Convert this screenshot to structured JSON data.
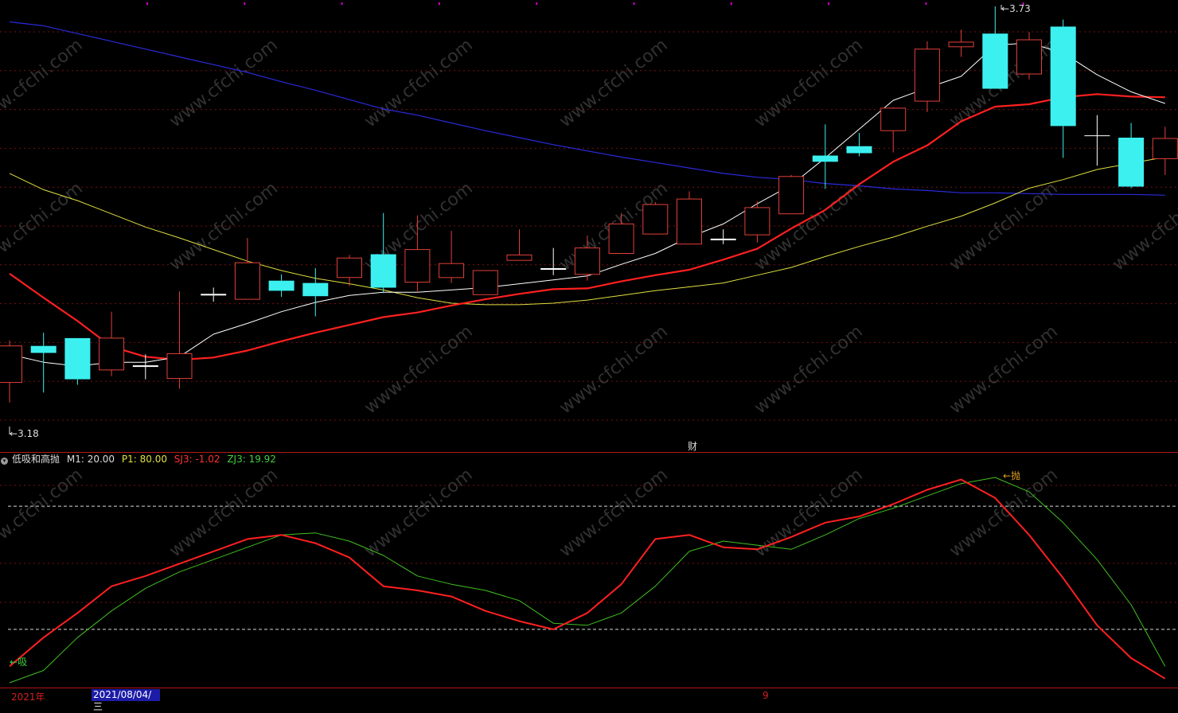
{
  "colors": {
    "background": "#000000",
    "grid": "#7a1010",
    "frame": "#b01818",
    "up": "#e0403a",
    "down": "#3cf0f0",
    "ma5": "#ffffff",
    "ma10": "#ff2020",
    "ma30": "#e0e040",
    "ma60": "#2a2adc",
    "k_line": "#ff2020",
    "d_line": "#40c020"
  },
  "top_markers": [
    "#cc00cc",
    "#cc00cc",
    "#cc00cc",
    "#cc00cc",
    "#cc00cc",
    "#cc00cc",
    "#cc00cc",
    "#cc00cc",
    "#cc00cc",
    "#cc00cc"
  ],
  "price_chart": {
    "high_label": "3.73",
    "low_label": "3.18",
    "event_label": "财"
  },
  "indicator": {
    "name": "低吸和高抛",
    "m1": "M1: 20.00",
    "p1": "P1: 80.00",
    "sj3": "SJ3: -1.02",
    "zj3": "ZJ3: 19.92",
    "buy_label": "吸",
    "sell_label": "抛"
  },
  "time_axis": {
    "year": "2021年",
    "cursor_date": "2021/08/04/三",
    "month": "9"
  },
  "watermark": "www.cfchi.com",
  "chart_data": {
    "type": "candlestick",
    "high": 3.73,
    "low": 3.18,
    "candles": [
      {
        "o": 3.246,
        "h": 3.3,
        "l": 3.22,
        "c": 3.293
      },
      {
        "o": 3.293,
        "h": 3.31,
        "l": 3.233,
        "c": 3.284
      },
      {
        "o": 3.303,
        "h": 3.303,
        "l": 3.243,
        "c": 3.25
      },
      {
        "o": 3.262,
        "h": 3.337,
        "l": 3.254,
        "c": 3.303
      },
      {
        "o": 3.268,
        "h": 3.282,
        "l": 3.25,
        "c": 3.266
      },
      {
        "o": 3.251,
        "h": 3.363,
        "l": 3.238,
        "c": 3.283
      },
      {
        "o": 3.36,
        "h": 3.368,
        "l": 3.35,
        "c": 3.358
      },
      {
        "o": 3.353,
        "h": 3.432,
        "l": 3.353,
        "c": 3.4
      },
      {
        "o": 3.377,
        "h": 3.385,
        "l": 3.356,
        "c": 3.364
      },
      {
        "o": 3.374,
        "h": 3.393,
        "l": 3.331,
        "c": 3.357
      },
      {
        "o": 3.381,
        "h": 3.41,
        "l": 3.37,
        "c": 3.406
      },
      {
        "o": 3.411,
        "h": 3.464,
        "l": 3.361,
        "c": 3.368
      },
      {
        "o": 3.375,
        "h": 3.461,
        "l": 3.362,
        "c": 3.417
      },
      {
        "o": 3.381,
        "h": 3.441,
        "l": 3.374,
        "c": 3.399
      },
      {
        "o": 3.359,
        "h": 3.387,
        "l": 3.359,
        "c": 3.39
      },
      {
        "o": 3.403,
        "h": 3.443,
        "l": 3.403,
        "c": 3.41
      },
      {
        "o": 3.391,
        "h": 3.419,
        "l": 3.384,
        "c": 3.393
      },
      {
        "o": 3.385,
        "h": 3.435,
        "l": 3.377,
        "c": 3.419
      },
      {
        "o": 3.412,
        "h": 3.464,
        "l": 3.412,
        "c": 3.45
      },
      {
        "o": 3.437,
        "h": 3.478,
        "l": 3.437,
        "c": 3.475
      },
      {
        "o": 3.424,
        "h": 3.492,
        "l": 3.424,
        "c": 3.482
      },
      {
        "o": 3.429,
        "h": 3.443,
        "l": 3.424,
        "c": 3.431
      },
      {
        "o": 3.436,
        "h": 3.479,
        "l": 3.426,
        "c": 3.471
      },
      {
        "o": 3.463,
        "h": 3.513,
        "l": 3.463,
        "c": 3.511
      },
      {
        "o": 3.538,
        "h": 3.578,
        "l": 3.495,
        "c": 3.53
      },
      {
        "o": 3.55,
        "h": 3.567,
        "l": 3.537,
        "c": 3.541
      },
      {
        "o": 3.57,
        "h": 3.6,
        "l": 3.542,
        "c": 3.599
      },
      {
        "o": 3.608,
        "h": 3.685,
        "l": 3.594,
        "c": 3.675
      },
      {
        "o": 3.678,
        "h": 3.7,
        "l": 3.665,
        "c": 3.684
      },
      {
        "o": 3.695,
        "h": 3.73,
        "l": 3.624,
        "c": 3.624
      },
      {
        "o": 3.643,
        "h": 3.697,
        "l": 3.636,
        "c": 3.687
      },
      {
        "o": 3.704,
        "h": 3.713,
        "l": 3.535,
        "c": 3.576
      },
      {
        "o": 3.564,
        "h": 3.59,
        "l": 3.525,
        "c": 3.564
      },
      {
        "o": 3.561,
        "h": 3.58,
        "l": 3.496,
        "c": 3.498
      },
      {
        "o": 3.534,
        "h": 3.575,
        "l": 3.513,
        "c": 3.56
      }
    ],
    "ma5": [
      3.282,
      3.272,
      3.267,
      3.272,
      3.272,
      3.279,
      3.308,
      3.322,
      3.337,
      3.349,
      3.358,
      3.362,
      3.362,
      3.365,
      3.368,
      3.373,
      3.378,
      3.383,
      3.398,
      3.412,
      3.433,
      3.45,
      3.476,
      3.5,
      3.535,
      3.572,
      3.609,
      3.625,
      3.64,
      3.68,
      3.683,
      3.67,
      3.642,
      3.62,
      3.605
    ],
    "ma10": [
      3.386,
      3.355,
      3.325,
      3.292,
      3.279,
      3.275,
      3.278,
      3.287,
      3.299,
      3.31,
      3.32,
      3.33,
      3.336,
      3.345,
      3.353,
      3.36,
      3.366,
      3.367,
      3.376,
      3.384,
      3.391,
      3.404,
      3.418,
      3.444,
      3.468,
      3.501,
      3.53,
      3.551,
      3.582,
      3.601,
      3.604,
      3.613,
      3.617,
      3.614,
      3.613
    ],
    "ma30": [
      3.515,
      3.494,
      3.48,
      3.463,
      3.446,
      3.432,
      3.417,
      3.402,
      3.39,
      3.38,
      3.373,
      3.365,
      3.355,
      3.348,
      3.346,
      3.346,
      3.348,
      3.352,
      3.358,
      3.364,
      3.369,
      3.374,
      3.384,
      3.394,
      3.408,
      3.421,
      3.433,
      3.447,
      3.46,
      3.477,
      3.496,
      3.507,
      3.52,
      3.528,
      3.536
    ],
    "ma60": [
      3.71,
      3.705,
      3.695,
      3.685,
      3.675,
      3.665,
      3.655,
      3.645,
      3.633,
      3.622,
      3.61,
      3.598,
      3.59,
      3.58,
      3.57,
      3.561,
      3.552,
      3.544,
      3.536,
      3.529,
      3.522,
      3.515,
      3.51,
      3.507,
      3.502,
      3.499,
      3.495,
      3.493,
      3.49,
      3.49,
      3.489,
      3.488,
      3.488,
      3.488,
      3.487
    ],
    "k": [
      2,
      16,
      28,
      41,
      46,
      52,
      58,
      64,
      66,
      62,
      55,
      41,
      39,
      36,
      29,
      24,
      20,
      28,
      42,
      64,
      66,
      60,
      59,
      65,
      72,
      75,
      81,
      88,
      93,
      84,
      66,
      45,
      22,
      6,
      -4
    ],
    "d": [
      -6,
      0,
      16,
      29,
      40,
      48,
      54,
      60,
      66,
      67,
      63,
      56,
      46,
      42,
      39,
      34,
      23,
      22,
      28,
      41,
      58,
      63,
      61,
      59,
      66,
      74,
      79,
      85,
      91,
      94,
      87,
      72,
      54,
      32,
      2
    ],
    "indicator_range": [
      -6,
      94
    ],
    "indicator_levels": [
      80,
      20
    ]
  }
}
